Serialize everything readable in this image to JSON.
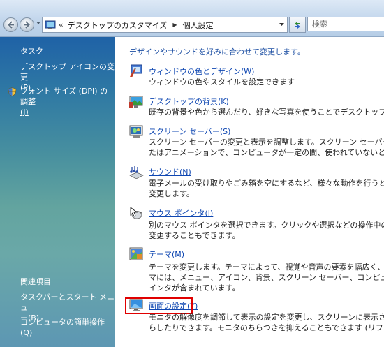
{
  "address_bar": {
    "overflow_marker": "«",
    "breadcrumb": [
      "デスクトップのカスタマイズ",
      "個人設定"
    ],
    "search_placeholder": "検索"
  },
  "left_pane": {
    "tasks_title": "タスク",
    "tasks": [
      {
        "label_line1": "デスクトップ アイコンの変更",
        "label_line2": "(P)",
        "icon": null
      },
      {
        "label_line1": "フォント サイズ (DPI) の調整",
        "label_line2": "(J)",
        "icon": "shield-icon"
      }
    ],
    "related_title": "関連項目",
    "related": [
      {
        "label_line1": "タスクバーとスタート メニュ",
        "label_line2": "ー(B)"
      },
      {
        "label_line1": "コンピュータの簡単操作(Q)",
        "label_line2": ""
      }
    ]
  },
  "main": {
    "intro": "デザインやサウンドを好みに合わせて変更します。",
    "items": [
      {
        "icon": "window-color-icon",
        "title": "ウィンドウの色とデザイン(W)",
        "desc": [
          "ウィンドウの色やスタイルを設定できます"
        ]
      },
      {
        "icon": "desktop-background-icon",
        "title": "デスクトップの背景(K)",
        "desc": [
          "既存の背景や色から選んだり、好きな写真を使うことでデスクトップを飾るこ"
        ]
      },
      {
        "icon": "screen-saver-icon",
        "title": "スクリーン セーバー(S)",
        "desc": [
          "スクリーン セーバーの変更と表示を調整します。スクリーン セーバーとは、表",
          "たはアニメーションで、コンピュータが一定の間、使われていないときに表示さ"
        ]
      },
      {
        "icon": "sound-icon",
        "title": "サウンド(N)",
        "desc": [
          "電子メールの受け取りやごみ箱を空にするなど、様々な動作を行うときに再生",
          "変更します。"
        ]
      },
      {
        "icon": "mouse-pointer-icon",
        "title": "マウス ポインタ(I)",
        "desc": [
          "別のマウス ポインタを選択できます。クリックや選択などの操作中のマウス ポ",
          "変更することもできます。"
        ]
      },
      {
        "icon": "theme-icon",
        "title": "テーマ(M)",
        "desc": [
          "テーマを変更します。テーマによって、視覚や音声の要素を幅広く、一度に変更",
          "マには、メニュー、アイコン、背景、スクリーン セーバー、コンピュータの効果",
          "インタが含まれています。"
        ]
      },
      {
        "icon": "display-settings-icon",
        "title": "画面の設定(Y)",
        "desc": [
          "モニタの解像度を調節して表示の設定を変更し、スクリーンに表示される項目",
          "らしたりできます。モニタのちらつきを抑えることもできます (リフレッシュ"
        ]
      }
    ]
  },
  "colors": {
    "link": "#0f47b2",
    "intro": "#1d4fa3",
    "highlight": "#e00000",
    "left_pane_top": "#1f62a6"
  }
}
